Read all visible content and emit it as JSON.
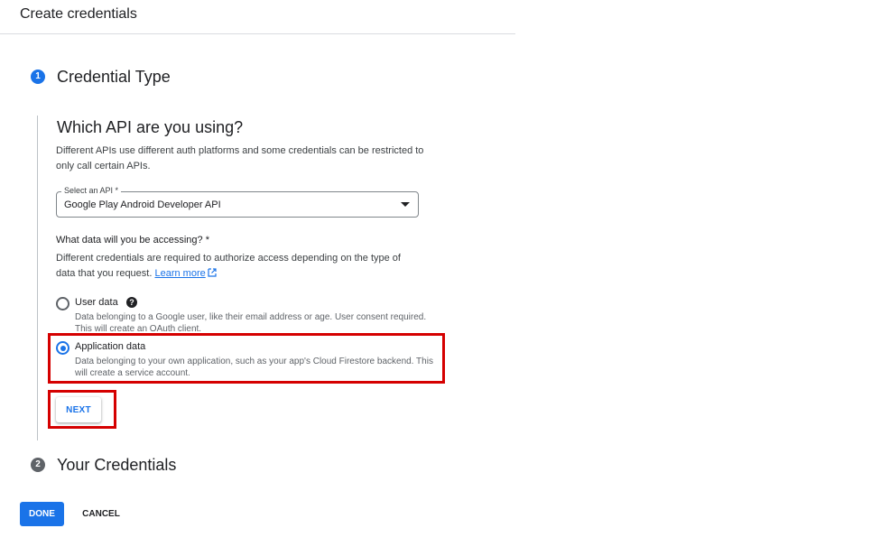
{
  "header": {
    "title": "Create credentials"
  },
  "steps": [
    {
      "number": "1",
      "title": "Credential Type"
    },
    {
      "number": "2",
      "title": "Your Credentials"
    }
  ],
  "credential_type": {
    "heading": "Which API are you using?",
    "description": "Different APIs use different auth platforms and some credentials can be restricted to only call certain APIs.",
    "select": {
      "label": "Select an API *",
      "value": "Google Play Android Developer API"
    },
    "question": "What data will you be accessing? *",
    "question_description": "Different credentials are required to authorize access depending on the type of data that you request.",
    "learn_more": "Learn more",
    "options": [
      {
        "label": "User data",
        "description": "Data belonging to a Google user, like their email address or age. User consent required. This will create an OAuth client.",
        "selected": false
      },
      {
        "label": "Application data",
        "description": "Data belonging to your own application, such as your app's Cloud Firestore backend. This will create a service account.",
        "selected": true
      }
    ],
    "next_label": "NEXT"
  },
  "footer": {
    "done_label": "DONE",
    "cancel_label": "CANCEL"
  },
  "colors": {
    "accent": "#1a73e8",
    "highlight": "#d50000"
  }
}
